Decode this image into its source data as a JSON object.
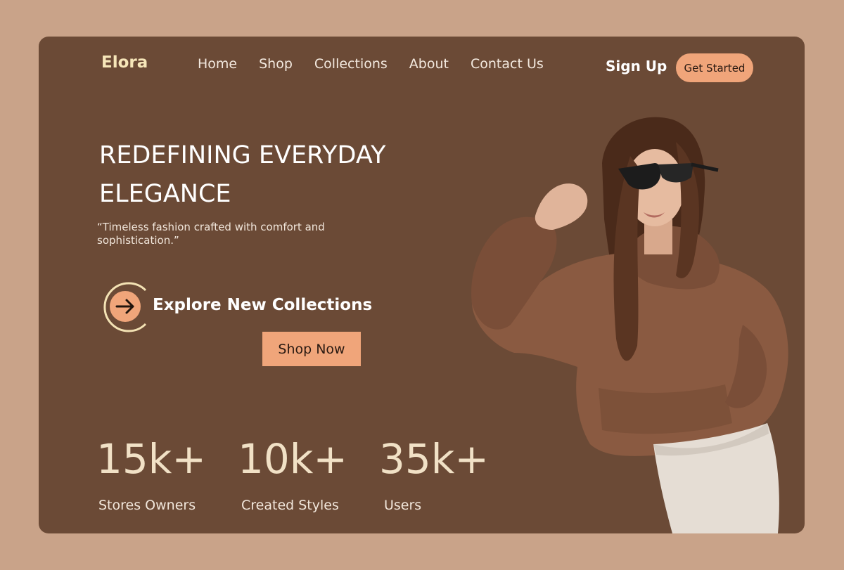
{
  "brand": {
    "name": "Elora"
  },
  "nav": {
    "items": [
      "Home",
      "Shop",
      "Collections",
      "About",
      "Contact Us"
    ]
  },
  "header": {
    "signup_label": "Sign Up",
    "get_started_label": "Get Started"
  },
  "hero": {
    "headline_line1": "REDEFINING EVERYDAY",
    "headline_line2": "ELEGANCE",
    "quote_line1": "“Timeless fashion crafted with comfort and",
    "quote_line2": " sophistication.”",
    "explore_label": "Explore New Collections",
    "explore_icon": "arrow-right-icon",
    "shop_now_label": "Shop Now"
  },
  "stats": [
    {
      "value": "15k+",
      "label": "Stores Owners"
    },
    {
      "value": "10k+",
      "label": "Created Styles"
    },
    {
      "value": "35k+",
      "label": "Users"
    }
  ],
  "colors": {
    "page_bg": "#c9a389",
    "card_bg": "#6b4a36",
    "accent": "#f0a57a",
    "brand": "#f6e6b9",
    "stat_value": "#f1e1c6"
  }
}
